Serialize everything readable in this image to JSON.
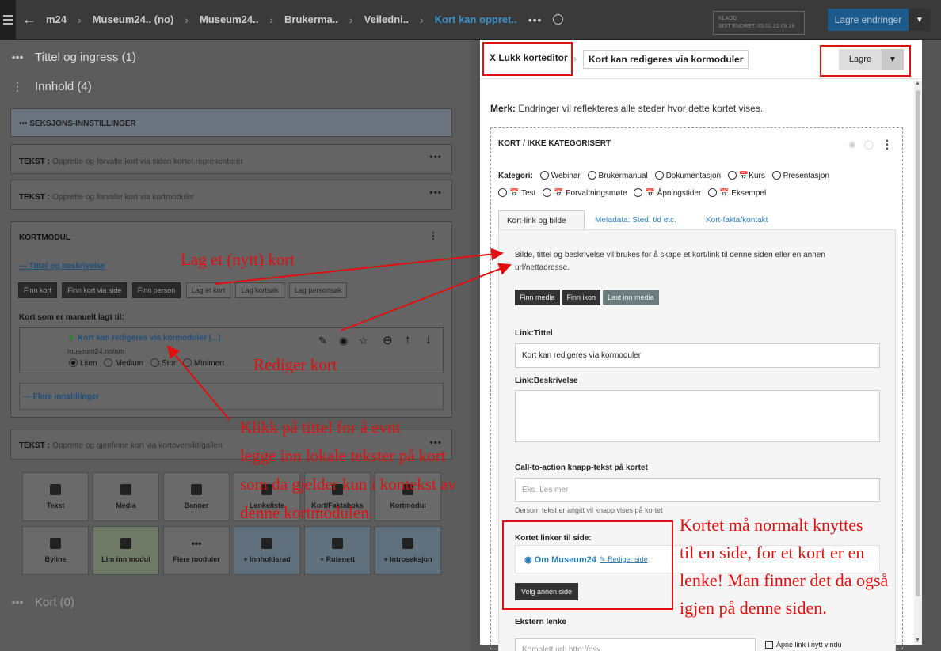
{
  "topbar": {
    "crumbs": [
      "m24",
      "Museum24.. (no)",
      "Museum24..",
      "Brukerma..",
      "Veiledni..",
      "Kort kan oppret.."
    ],
    "status_line1": "KLADD",
    "status_line2": "SIST ENDRET: 05.01.21 09:19",
    "save_label": "Lagre endringer"
  },
  "left": {
    "sections": [
      {
        "label": "Tittel og ingress (1)"
      },
      {
        "label": "Innhold (4)"
      },
      {
        "label": "Kort (0)"
      }
    ],
    "seksjon": "SEKSJONS-INNSTILLINGER",
    "tekst_label": "TEKST :",
    "tekst1": "Opprette og forvalte kort via siden kortet representerer",
    "tekst2": "Opprette og forvalte kort via kortmoduler",
    "tekst3": "Opprette og gjenfinne kort via kortoversikt/galleri",
    "kortmodul_title": "KORTMODUL",
    "tittel_link": "--- Tittel og beskrivelse",
    "buttons": [
      "Finn kort",
      "Finn kort via side",
      "Finn person",
      "Lag et kort",
      "Lag kortsøk",
      "Lag personsøk"
    ],
    "manual_label": "Kort som er manuelt lagt til:",
    "card_title": "Kort kan redigeres via kormoduler (...)",
    "card_url": "museum24.no/om",
    "sizes": [
      "Liten",
      "Medium",
      "Stor",
      "Minimert"
    ],
    "flere": "--- Flere innstillinger",
    "tiles": [
      "Tekst",
      "Media",
      "Banner",
      "Lenkeliste",
      "Kort/Faktaboks",
      "Kortmodul",
      "Byline",
      "Lim inn modul",
      "Flere moduler",
      "+ Innholdsrad",
      "+ Rutenett",
      "+ Introseksjon"
    ]
  },
  "panel": {
    "close": "X Lukk korteditor",
    "title": "Kort kan redigeres via kormoduler",
    "save": "Lagre",
    "note_bold": "Merk:",
    "note": "Endringer vil reflekteres alle steder hvor dette kortet vises.",
    "card_heading": "KORT / IKKE KATEGORISERT",
    "kategori_label": "Kategori:",
    "kategorier_row1": [
      "Webinar",
      "Brukermanual",
      "Dokumentasjon",
      "Kurs",
      "Presentasjon"
    ],
    "kategorier_row2": [
      "Test",
      "Forvaltningsmøte",
      "Åpningstider",
      "Eksempel"
    ],
    "tabs": [
      "Kort-link og bilde",
      "Metadata: Sted, tid etc.",
      "Kort-fakta/kontakt"
    ],
    "intro": "Bilde, tittel og beskrivelse vil brukes for å skape et kort/link til denne siden eller en annen url/nettadresse.",
    "media_buttons": [
      "Finn media",
      "Finn ikon",
      "Last inn media"
    ],
    "link_title_label": "Link:Tittel",
    "link_title_value": "Kort kan redigeres via kormoduler",
    "link_desc_label": "Link:Beskrivelse",
    "cta_label": "Call-to-action knapp-tekst på kortet",
    "cta_placeholder": "Eks. Les mer",
    "cta_hint": "Dersom tekst er angitt vil knapp vises på kortet",
    "linker_label": "Kortet linker til side:",
    "linker_page": "Om Museum24",
    "linker_edit": "Rediger side",
    "velg": "Velg annen side",
    "ext_label": "Ekstern lenke",
    "ext_placeholder": "Komplett url: http://osv",
    "ext_checkbox": "Åpne link i nytt vindu"
  },
  "annotations": {
    "lag": "Lag et (nytt) kort",
    "rediger": "Rediger kort",
    "klikk": [
      "Klikk på tittel for å evnt",
      "legge inn lokale tekster på kort",
      "som da gjelder kun i kontekst av",
      "denne kortmodulen."
    ],
    "kortet": [
      "Kortet må normalt knyttes",
      "til en side, for et kort er en",
      "lenke! Man finner det da også",
      "igjen på denne siden."
    ],
    "color": "#e01010"
  }
}
